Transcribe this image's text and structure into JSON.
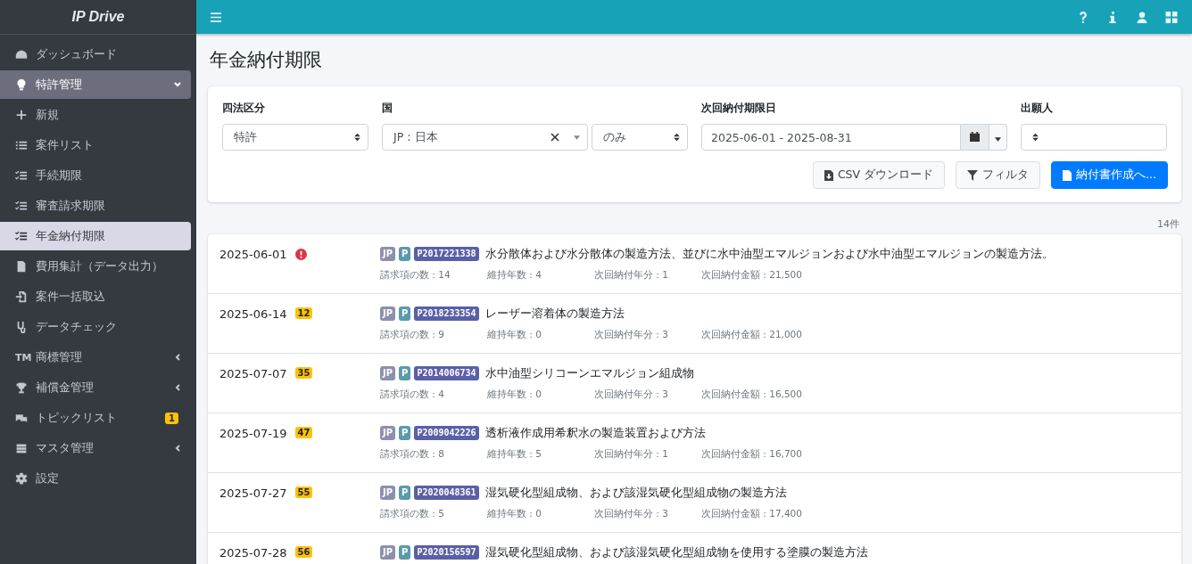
{
  "brand": "IP Drive",
  "sidebar": {
    "items": [
      {
        "label": "ダッシュボード",
        "selected": false
      },
      {
        "label": "特許管理",
        "selected": false,
        "expanded": true,
        "children": [
          {
            "label": "新規",
            "selected": false
          },
          {
            "label": "案件リスト",
            "selected": false
          },
          {
            "label": "手続期限",
            "selected": false
          },
          {
            "label": "審査請求期限",
            "selected": false
          },
          {
            "label": "年金納付期限",
            "selected": true
          },
          {
            "label": "費用集計（データ出力）",
            "selected": false
          },
          {
            "label": "案件一括取込",
            "selected": false
          },
          {
            "label": "データチェック",
            "selected": false
          }
        ]
      },
      {
        "label": "商標管理",
        "mark": "TM",
        "selected": false,
        "expanded": false
      },
      {
        "label": "補償金管理",
        "selected": false,
        "expanded": false
      },
      {
        "label": "トピックリスト",
        "selected": false,
        "badge": "1"
      },
      {
        "label": "マスタ管理",
        "selected": false,
        "expanded": false
      },
      {
        "label": "設定",
        "selected": false
      }
    ]
  },
  "page_title": "年金納付期限",
  "filters": {
    "law_type": {
      "label": "四法区分",
      "value": "特許"
    },
    "country": {
      "label": "国",
      "value": "JP：日本",
      "scope": "のみ"
    },
    "next_due_date": {
      "label": "次回納付期限日",
      "value": "2025-06-01 - 2025-08-31"
    },
    "applicant": {
      "label": "出願人"
    }
  },
  "buttons": [
    {
      "label": "CSV ダウンロード",
      "kind": "secondary"
    },
    {
      "label": "フィルタ",
      "kind": "secondary"
    },
    {
      "label": "納付書作成へ...",
      "kind": "primary"
    }
  ],
  "count": "14件",
  "rows": [
    {
      "date": "2025-06-01",
      "badge": {
        "kind": "alert"
      },
      "country": "JP",
      "type": "P",
      "number": "P2017221338",
      "title": "水分散体および水分散体の製造方法、並びに水中油型エマルジョンおよび水中油型エマルジョンの製造方法。",
      "meta": [
        "請求項の数 : 14",
        "維持年数 : 4",
        "次回納付年分 : 1",
        "次回納付金額 : 21,500"
      ]
    },
    {
      "date": "2025-06-14",
      "badge": {
        "kind": "days",
        "text": "12"
      },
      "country": "JP",
      "type": "P",
      "number": "P2018233354",
      "title": "レーザー溶着体の製造方法",
      "meta": [
        "請求項の数 : 9",
        "維持年数 : 0",
        "次回納付年分 : 3",
        "次回納付金額 : 21,000"
      ]
    },
    {
      "date": "2025-07-07",
      "badge": {
        "kind": "days",
        "text": "35"
      },
      "country": "JP",
      "type": "P",
      "number": "P2014006734",
      "title": "水中油型シリコーンエマルジョン組成物",
      "meta": [
        "請求項の数 : 4",
        "維持年数 : 0",
        "次回納付年分 : 3",
        "次回納付金額 : 16,500"
      ]
    },
    {
      "date": "2025-07-19",
      "badge": {
        "kind": "days",
        "text": "47"
      },
      "country": "JP",
      "type": "P",
      "number": "P2009042226",
      "title": "透析液作成用希釈水の製造装置および方法",
      "meta": [
        "請求項の数 : 8",
        "維持年数 : 5",
        "次回納付年分 : 1",
        "次回納付金額 : 16,700"
      ]
    },
    {
      "date": "2025-07-27",
      "badge": {
        "kind": "days",
        "text": "55"
      },
      "country": "JP",
      "type": "P",
      "number": "P2020048361",
      "title": "湿気硬化型組成物、および該湿気硬化型組成物の製造方法",
      "meta": [
        "請求項の数 : 5",
        "維持年数 : 0",
        "次回納付年分 : 3",
        "次回納付金額 : 17,400"
      ]
    },
    {
      "date": "2025-07-28",
      "badge": {
        "kind": "days",
        "text": "56"
      },
      "country": "JP",
      "type": "P",
      "number": "P2020156597",
      "title": "湿気硬化型組成物、および該湿気硬化型組成物を使用する塗膜の製造方法"
    }
  ]
}
